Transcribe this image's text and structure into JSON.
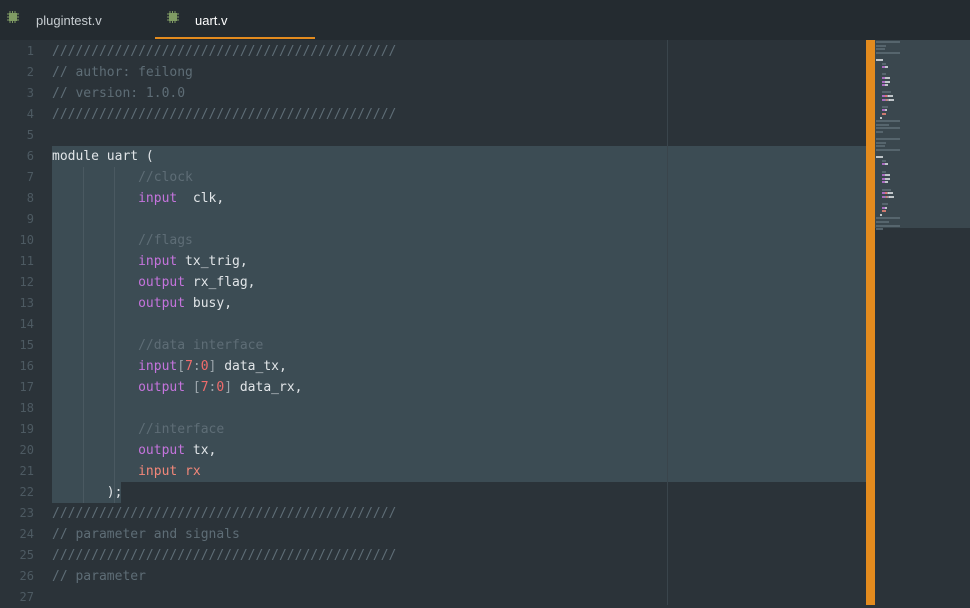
{
  "tabs": [
    {
      "label": "plugintest.v",
      "active": false
    },
    {
      "label": "uart.v",
      "active": true
    }
  ],
  "editor": {
    "lines": [
      {
        "num": "1",
        "tokens": [
          {
            "t": "////////////////////////////////////////////",
            "c": "c"
          }
        ]
      },
      {
        "num": "2",
        "tokens": [
          {
            "t": "// author: feilong",
            "c": "c"
          }
        ]
      },
      {
        "num": "3",
        "tokens": [
          {
            "t": "// version: 1.0.0",
            "c": "c"
          }
        ]
      },
      {
        "num": "4",
        "tokens": [
          {
            "t": "////////////////////////////////////////////",
            "c": "c"
          }
        ]
      },
      {
        "num": "5",
        "tokens": []
      },
      {
        "num": "6",
        "tokens": [
          {
            "t": "module",
            "c": "w"
          },
          {
            "t": " uart (",
            "c": "w"
          }
        ]
      },
      {
        "num": "7",
        "tokens": [
          {
            "t": "           ",
            "c": "w"
          },
          {
            "t": "//clock",
            "c": "c"
          }
        ]
      },
      {
        "num": "8",
        "tokens": [
          {
            "t": "           ",
            "c": "w"
          },
          {
            "t": "input",
            "c": "k"
          },
          {
            "t": "  clk,",
            "c": "w"
          }
        ]
      },
      {
        "num": "9",
        "tokens": []
      },
      {
        "num": "10",
        "tokens": [
          {
            "t": "           ",
            "c": "w"
          },
          {
            "t": "//flags",
            "c": "c"
          }
        ]
      },
      {
        "num": "11",
        "tokens": [
          {
            "t": "           ",
            "c": "w"
          },
          {
            "t": "input",
            "c": "k"
          },
          {
            "t": " tx_trig,",
            "c": "w"
          }
        ]
      },
      {
        "num": "12",
        "tokens": [
          {
            "t": "           ",
            "c": "w"
          },
          {
            "t": "output",
            "c": "k"
          },
          {
            "t": " rx_flag,",
            "c": "w"
          }
        ]
      },
      {
        "num": "13",
        "tokens": [
          {
            "t": "           ",
            "c": "w"
          },
          {
            "t": "output",
            "c": "k"
          },
          {
            "t": " busy,",
            "c": "w"
          }
        ]
      },
      {
        "num": "14",
        "tokens": []
      },
      {
        "num": "15",
        "tokens": [
          {
            "t": "           ",
            "c": "w"
          },
          {
            "t": "//data interface",
            "c": "c"
          }
        ]
      },
      {
        "num": "16",
        "tokens": [
          {
            "t": "           ",
            "c": "w"
          },
          {
            "t": "input",
            "c": "k"
          },
          {
            "t": "[",
            "c": "p"
          },
          {
            "t": "7",
            "c": "n"
          },
          {
            "t": ":",
            "c": "p"
          },
          {
            "t": "0",
            "c": "n"
          },
          {
            "t": "]",
            "c": "p"
          },
          {
            "t": " data_tx,",
            "c": "w"
          }
        ]
      },
      {
        "num": "17",
        "tokens": [
          {
            "t": "           ",
            "c": "w"
          },
          {
            "t": "output",
            "c": "k"
          },
          {
            "t": " [",
            "c": "p"
          },
          {
            "t": "7",
            "c": "n"
          },
          {
            "t": ":",
            "c": "p"
          },
          {
            "t": "0",
            "c": "n"
          },
          {
            "t": "]",
            "c": "p"
          },
          {
            "t": " data_rx,",
            "c": "w"
          }
        ]
      },
      {
        "num": "18",
        "tokens": []
      },
      {
        "num": "19",
        "tokens": [
          {
            "t": "           ",
            "c": "w"
          },
          {
            "t": "//interface",
            "c": "c"
          }
        ]
      },
      {
        "num": "20",
        "tokens": [
          {
            "t": "           ",
            "c": "w"
          },
          {
            "t": "output",
            "c": "k"
          },
          {
            "t": " tx,",
            "c": "w"
          }
        ]
      },
      {
        "num": "21",
        "tokens": [
          {
            "t": "           ",
            "c": "w"
          },
          {
            "t": "input rx",
            "c": "e"
          }
        ]
      },
      {
        "num": "22",
        "tokens": [
          {
            "t": "       ",
            "c": "w"
          },
          {
            "t": ");",
            "c": "w"
          }
        ]
      },
      {
        "num": "23",
        "tokens": [
          {
            "t": "////////////////////////////////////////////",
            "c": "c"
          }
        ]
      },
      {
        "num": "24",
        "tokens": [
          {
            "t": "// parameter and signals",
            "c": "c"
          }
        ]
      },
      {
        "num": "25",
        "tokens": [
          {
            "t": "////////////////////////////////////////////",
            "c": "c"
          }
        ]
      },
      {
        "num": "26",
        "tokens": [
          {
            "t": "// parameter",
            "c": "c"
          }
        ]
      },
      {
        "num": "27",
        "tokens": []
      }
    ]
  },
  "colors": {
    "accent": "#e38b1e",
    "background": "#2b3339",
    "selection": "#3c4c54",
    "keyword": "#c574dd",
    "number": "#f06c6c",
    "comment": "#5e6d76"
  },
  "icons": {
    "tab": "chip-icon"
  }
}
